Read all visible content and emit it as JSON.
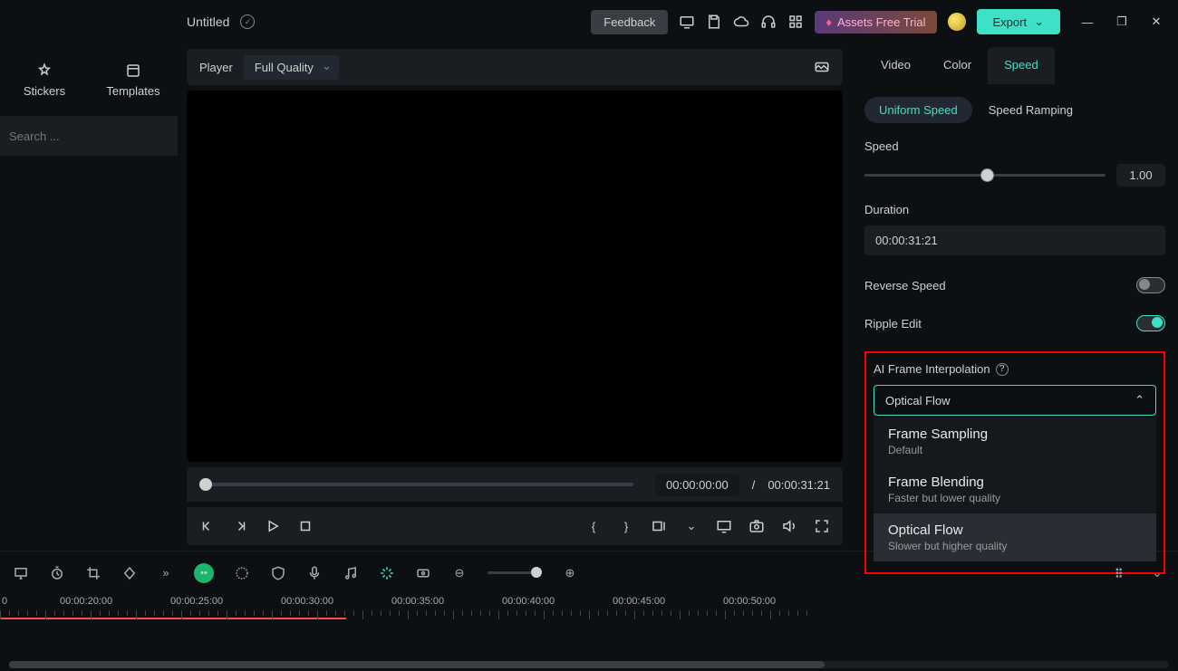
{
  "topbar": {
    "title": "Untitled",
    "feedback": "Feedback",
    "assets_trial": "Assets Free Trial",
    "export": "Export"
  },
  "library": {
    "stickers": "Stickers",
    "templates": "Templates",
    "search_placeholder": "Search ..."
  },
  "player": {
    "label": "Player",
    "quality": "Full Quality",
    "current_time": "00:00:00:00",
    "sep": "/",
    "total_time": "00:00:31:21"
  },
  "inspector": {
    "tabs": {
      "video": "Video",
      "color": "Color",
      "speed": "Speed"
    },
    "subtabs": {
      "uniform": "Uniform Speed",
      "ramping": "Speed Ramping"
    },
    "speed_label": "Speed",
    "speed_value": "1.00",
    "duration_label": "Duration",
    "duration_value": "00:00:31:21",
    "reverse_label": "Reverse Speed",
    "ripple_label": "Ripple Edit",
    "ai_label": "AI Frame Interpolation",
    "dropdown_value": "Optical Flow",
    "options": {
      "sampling_t": "Frame Sampling",
      "sampling_s": "Default",
      "blending_t": "Frame Blending",
      "blending_s": "Faster but lower quality",
      "optical_t": "Optical Flow",
      "optical_s": "Slower but higher quality"
    }
  },
  "timeline": {
    "tc0": "0",
    "tc1": "00:00:20:00",
    "tc2": "00:00:25:00",
    "tc3": "00:00:30:00",
    "tc4": "00:00:35:00",
    "tc5": "00:00:40:00",
    "tc6": "00:00:45:00",
    "tc7": "00:00:50:00"
  }
}
